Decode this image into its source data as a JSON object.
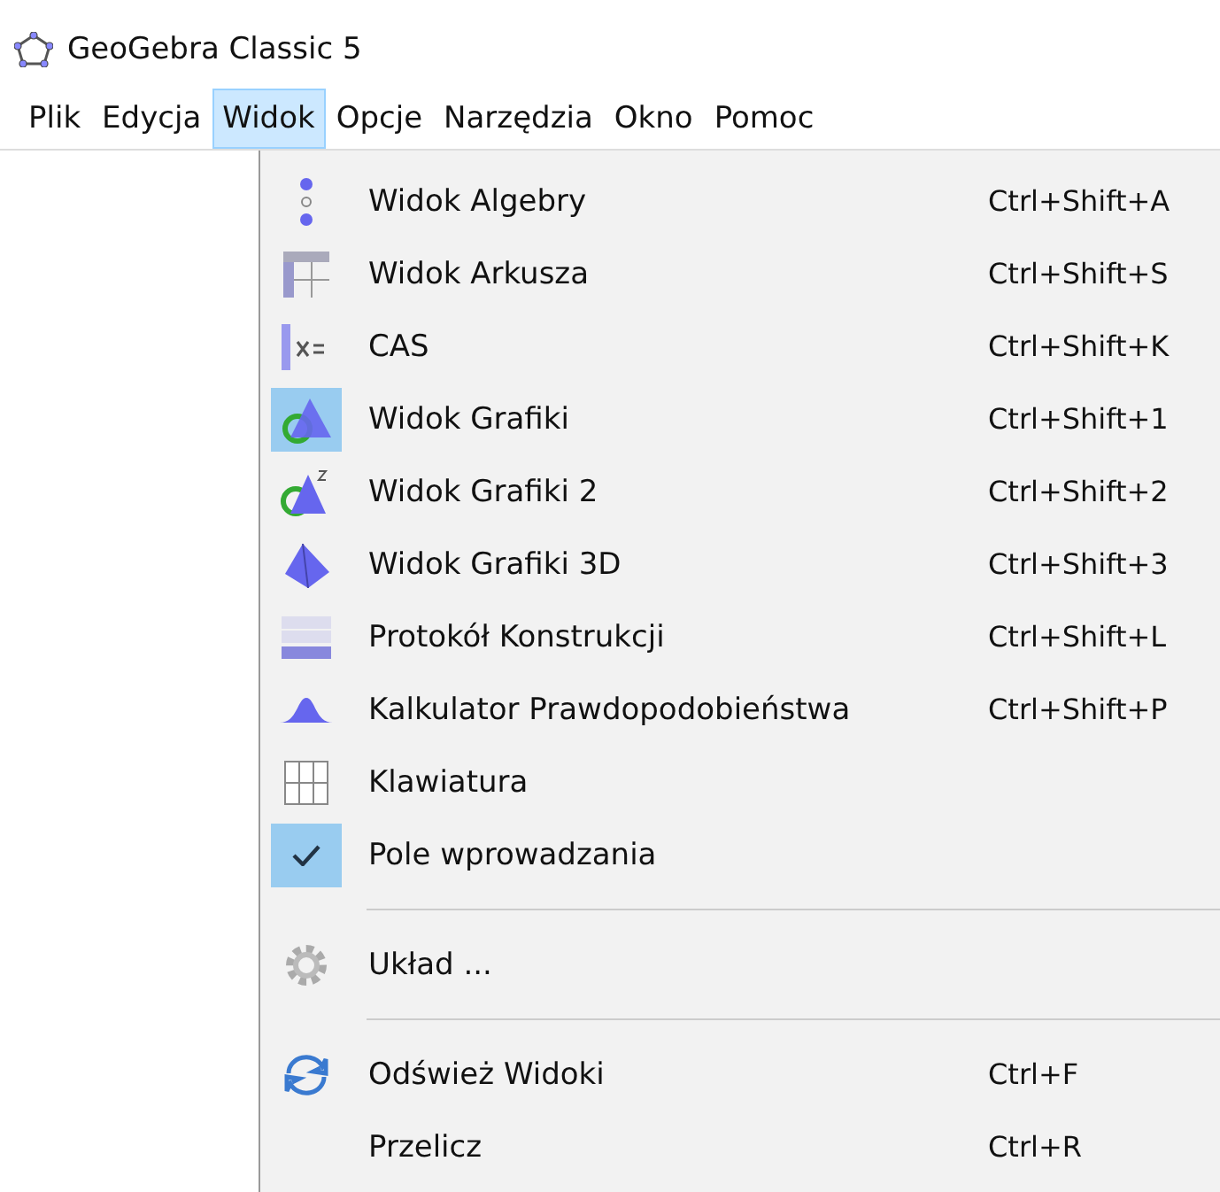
{
  "window": {
    "title": "GeoGebra Classic 5"
  },
  "menubar": [
    {
      "label": "Plik",
      "selected": false
    },
    {
      "label": "Edycja",
      "selected": false
    },
    {
      "label": "Widok",
      "selected": true
    },
    {
      "label": "Opcje",
      "selected": false
    },
    {
      "label": "Narzędzia",
      "selected": false
    },
    {
      "label": "Okno",
      "selected": false
    },
    {
      "label": "Pomoc",
      "selected": false
    }
  ],
  "menu": {
    "sections": [
      [
        {
          "label": "Widok Algebry",
          "shortcut": "Ctrl+Shift+A",
          "on": false
        },
        {
          "label": "Widok Arkusza",
          "shortcut": "Ctrl+Shift+S",
          "on": false
        },
        {
          "label": "CAS",
          "shortcut": "Ctrl+Shift+K",
          "on": false
        },
        {
          "label": "Widok Grafiki",
          "shortcut": "Ctrl+Shift+1",
          "on": true
        },
        {
          "label": "Widok Grafiki 2",
          "shortcut": "Ctrl+Shift+2",
          "on": false
        },
        {
          "label": "Widok Grafiki 3D",
          "shortcut": "Ctrl+Shift+3",
          "on": false
        },
        {
          "label": "Protokół Konstrukcji",
          "shortcut": "Ctrl+Shift+L",
          "on": false
        },
        {
          "label": "Kalkulator Prawdopodobieństwa",
          "shortcut": "Ctrl+Shift+P",
          "on": false
        },
        {
          "label": "Klawiatura",
          "on": false
        },
        {
          "label": "Pole wprowadzania",
          "on": true
        }
      ],
      [
        {
          "label": "Układ ...",
          "on": false
        }
      ],
      [
        {
          "label": "Odśwież Widoki",
          "shortcut": "Ctrl+F",
          "on": false
        },
        {
          "label": "Przelicz",
          "shortcut": "Ctrl+R",
          "on": false
        }
      ]
    ]
  }
}
